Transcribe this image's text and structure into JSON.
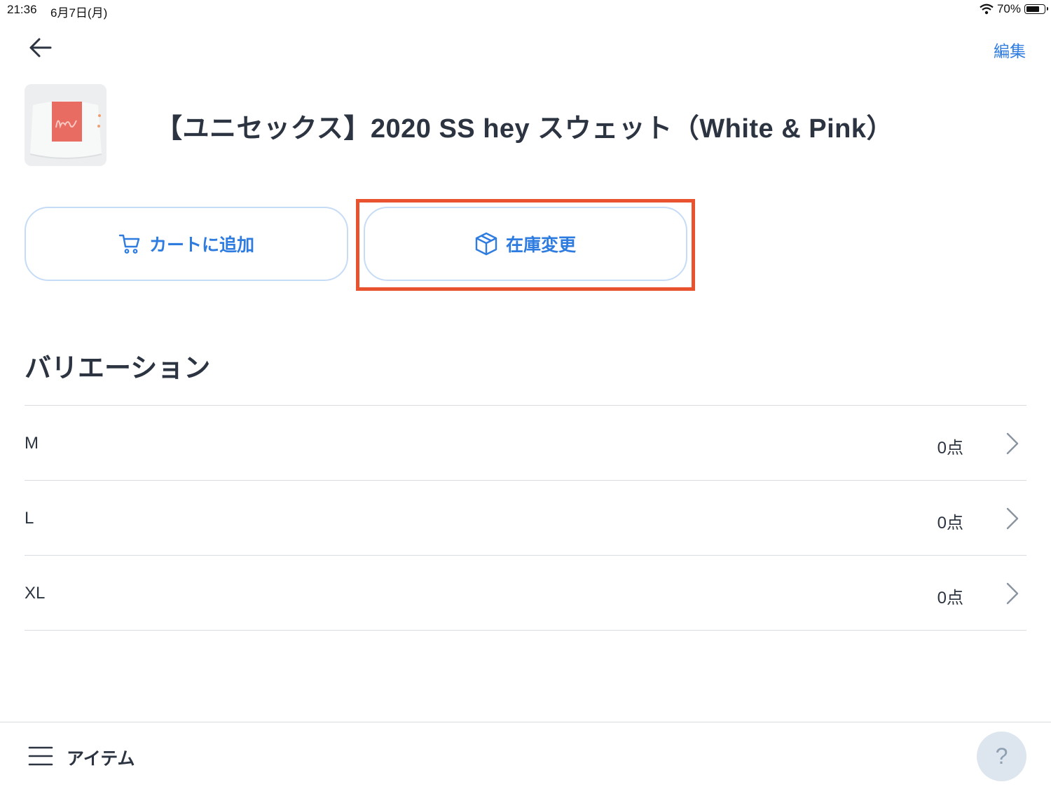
{
  "status_bar": {
    "time": "21:36",
    "date": "6月7日(月)",
    "battery": "70%"
  },
  "header": {
    "edit_label": "編集"
  },
  "product": {
    "title": "【ユニセックス】2020 SS hey スウェット（White & Pink）"
  },
  "actions": {
    "add_to_cart": "カートに追加",
    "change_stock": "在庫変更"
  },
  "variations": {
    "title": "バリエーション",
    "items": [
      {
        "size": "M",
        "count": "0点"
      },
      {
        "size": "L",
        "count": "0点"
      },
      {
        "size": "XL",
        "count": "0点"
      }
    ]
  },
  "bottom_bar": {
    "label": "アイテム",
    "help": "?"
  },
  "colors": {
    "accent": "#2f7ce0",
    "highlight": "#e8522f",
    "text": "#2b3440"
  },
  "icons": [
    "back-arrow-icon",
    "cart-icon",
    "box-icon",
    "chevron-right-icon",
    "menu-icon",
    "wifi-icon",
    "battery-icon"
  ]
}
